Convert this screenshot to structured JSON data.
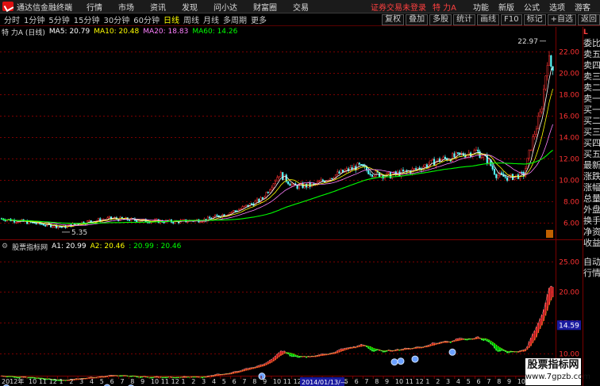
{
  "menubar": {
    "app_title": "通达信金融终端",
    "items": [
      "行情",
      "市场",
      "资讯",
      "发现",
      "问小达",
      "财富圈",
      "交易"
    ],
    "login_warning": "证券交易未登录",
    "stock_name": "特 力A",
    "right_items": [
      "功能",
      "新版",
      "公式",
      "选项",
      "游客"
    ]
  },
  "periods": {
    "items": [
      "分时",
      "1分钟",
      "5分钟",
      "15分钟",
      "30分钟",
      "60分钟",
      "日线",
      "周线",
      "月线",
      "多周期",
      "更多"
    ],
    "active": "日线"
  },
  "tools": [
    "复权",
    "叠加",
    "多股",
    "统计",
    "画线",
    "F10",
    "标记",
    "+自选",
    "返回"
  ],
  "main_indicator": {
    "title": "特 力A (日线)",
    "ma5": "MA5: 20.79",
    "ma10": "MA10: 20.48",
    "ma20": "MA20: 18.83",
    "ma60": "MA60: 14.26"
  },
  "sub_indicator": {
    "title": "股票指标网",
    "a1": "A1: 20.99",
    "a2": "A2: 20.46",
    "extra": ": 20.99 : 20.46"
  },
  "main_axis": [
    "22.00",
    "20.00",
    "18.00",
    "16.00",
    "14.00",
    "12.00",
    "10.00",
    "8.00",
    "6.00"
  ],
  "sub_axis": [
    "25.00",
    "20.00",
    "15.00",
    "10.00"
  ],
  "current_price_tag": "14.59",
  "high_label": "22.97",
  "low_label": "5.35",
  "date_axis": {
    "start_label": "2012年",
    "months": [
      "10",
      "11",
      "12",
      "1",
      "2",
      "3",
      "4",
      "5",
      "6",
      "7",
      "8",
      "9",
      "10",
      "11",
      "12",
      "1",
      "2",
      "3",
      "4",
      "5",
      "6",
      "7",
      "8",
      "9",
      "10",
      "11",
      "12",
      "1",
      "2",
      "3",
      "4",
      "5",
      "6",
      "7",
      "8",
      "9",
      "10",
      "11",
      "12",
      "1",
      "2",
      "3",
      "4",
      "5",
      "6",
      "7",
      "8",
      "9",
      "10",
      "11",
      "12",
      "1",
      "2"
    ],
    "cursor_date": "2014/01/13/—"
  },
  "right_panel": {
    "top_badge": "L",
    "items": [
      "委比",
      "卖五",
      "卖四",
      "卖三",
      "卖二",
      "卖一",
      "买一",
      "买二",
      "买三",
      "买四",
      "买五",
      "最新",
      "涨跌",
      "涨幅",
      "总量",
      "外盘",
      "换手",
      "净资",
      "收益",
      "自动",
      "行情"
    ]
  },
  "watermark": {
    "line1": "股票指标网",
    "line2": "www.7gpzb.com"
  },
  "colors": {
    "up": "#ff3232",
    "down": "#54fcfc",
    "ma5": "#ffffff",
    "ma10": "#ffff00",
    "ma20": "#ff80ff",
    "ma60": "#00ff00",
    "grid": "#7a0000"
  }
}
